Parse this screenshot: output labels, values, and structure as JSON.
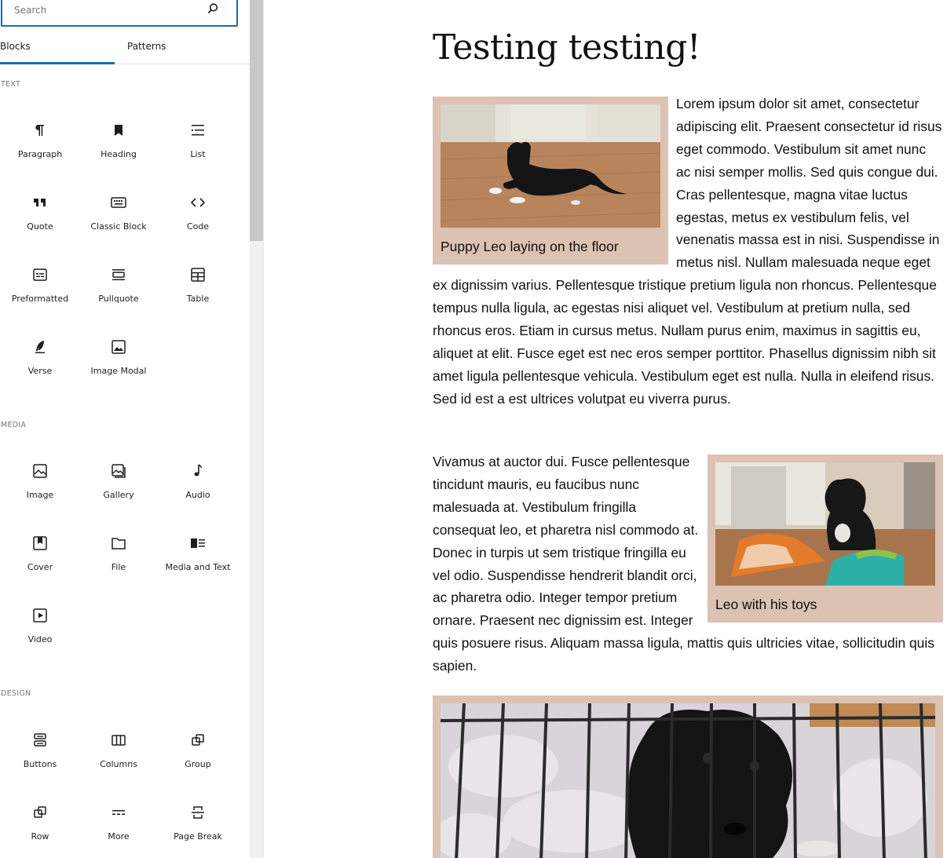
{
  "inserter": {
    "search": {
      "placeholder": "Search"
    },
    "tabs": [
      {
        "label": "Blocks",
        "active": true
      },
      {
        "label": "Patterns",
        "active": false
      }
    ],
    "categories": [
      {
        "title": "Text",
        "blocks": [
          {
            "label": "Paragraph",
            "icon": "paragraph-icon"
          },
          {
            "label": "Heading",
            "icon": "heading-icon"
          },
          {
            "label": "List",
            "icon": "list-icon"
          },
          {
            "label": "Quote",
            "icon": "quote-icon"
          },
          {
            "label": "Classic Block",
            "icon": "keyboard-icon"
          },
          {
            "label": "Code",
            "icon": "code-icon"
          },
          {
            "label": "Preformatted",
            "icon": "preformatted-icon"
          },
          {
            "label": "Pullquote",
            "icon": "pullquote-icon"
          },
          {
            "label": "Table",
            "icon": "table-icon"
          },
          {
            "label": "Verse",
            "icon": "verse-icon"
          },
          {
            "label": "Image Modal",
            "icon": "image-modal-icon"
          }
        ]
      },
      {
        "title": "Media",
        "blocks": [
          {
            "label": "Image",
            "icon": "image-icon"
          },
          {
            "label": "Gallery",
            "icon": "gallery-icon"
          },
          {
            "label": "Audio",
            "icon": "audio-icon"
          },
          {
            "label": "Cover",
            "icon": "cover-icon"
          },
          {
            "label": "File",
            "icon": "file-icon"
          },
          {
            "label": "Media and Text",
            "icon": "media-text-icon"
          },
          {
            "label": "Video",
            "icon": "video-icon"
          }
        ]
      },
      {
        "title": "Design",
        "blocks": [
          {
            "label": "Buttons",
            "icon": "buttons-icon"
          },
          {
            "label": "Columns",
            "icon": "columns-icon"
          },
          {
            "label": "Group",
            "icon": "group-icon"
          },
          {
            "label": "Row",
            "icon": "row-icon"
          },
          {
            "label": "More",
            "icon": "more-icon"
          },
          {
            "label": "Page Break",
            "icon": "page-break-icon"
          }
        ]
      }
    ]
  },
  "post": {
    "title": "Testing testing!",
    "figure1_caption": "Puppy Leo laying on the floor",
    "paragraph1": "Lorem ipsum dolor sit amet, consectetur adipiscing elit. Praesent consectetur id risus eget commodo. Vestibulum sit amet nunc ac nisi semper mollis. Sed quis congue dui. Cras pellentesque, magna vitae luctus egestas, metus ex vestibulum felis, vel venenatis massa est in nisi. Suspendisse in metus nisl. Nullam malesuada neque eget ex dignissim varius. Pellentesque tristique pretium ligula non rhoncus. Pellentesque tempus nulla ligula, ac egestas nisi aliquet vel. Vestibulum at pretium nulla, sed rhoncus eros. Etiam in cursus metus. Nullam purus enim, maximus in sagittis eu, aliquet at elit. Fusce eget est nec eros semper porttitor. Phasellus dignissim nibh sit amet ligula pellentesque vehicula. Vestibulum eget est nulla. Nulla in eleifend risus. Sed id est a est ultrices volutpat eu viverra purus.",
    "figure2_caption": "Leo with his toys",
    "paragraph2": "Vivamus at auctor dui. Fusce pellentesque tincidunt mauris, eu faucibus nunc malesuada at. Vestibulum fringilla consequat leo, et pharetra nisl commodo at. Donec in turpis ut sem tristique fringilla eu vel odio. Suspendisse hendrerit blandit orci, ac pharetra odio. Integer tempor pretium ornare. Praesent nec dignissim est. Integer quis posuere risus. Aliquam massa ligula, mattis quis ultricies vitae, sollicitudin quis sapien."
  },
  "colors": {
    "accent": "#1c6bb1",
    "figure_bg": "#dcc2b2",
    "muted": "#757575"
  }
}
